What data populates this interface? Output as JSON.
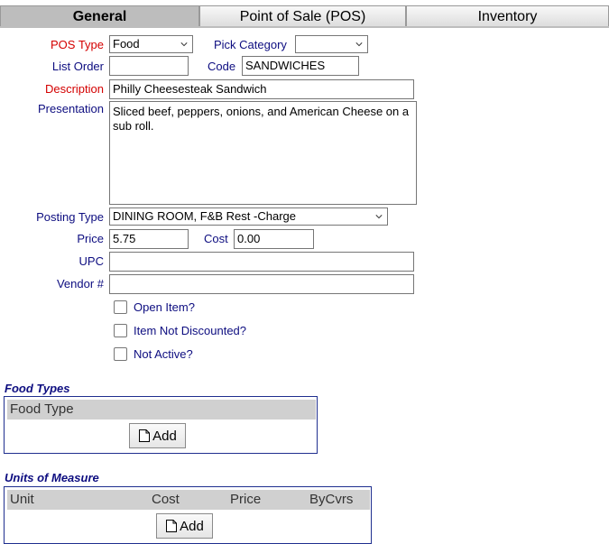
{
  "tabs": [
    {
      "label": "General",
      "active": true
    },
    {
      "label": "Point of Sale (POS)",
      "active": false
    },
    {
      "label": "Inventory",
      "active": false
    }
  ],
  "form": {
    "pos_type_label": "POS Type",
    "pos_type_value": "Food",
    "pick_category_label": "Pick Category",
    "pick_category_value": "",
    "list_order_label": "List Order",
    "list_order_value": "",
    "code_label": "Code",
    "code_value": "SANDWICHES",
    "description_label": "Description",
    "description_value": "Philly Cheesesteak Sandwich",
    "presentation_label": "Presentation",
    "presentation_value": "Sliced beef, peppers, onions, and American Cheese on a sub roll.",
    "posting_type_label": "Posting Type",
    "posting_type_value": "DINING ROOM, F&B Rest -Charge",
    "price_label": "Price",
    "price_value": "5.75",
    "cost_label": "Cost",
    "cost_value": "0.00",
    "upc_label": "UPC",
    "upc_value": "",
    "vendor_label": "Vendor #",
    "vendor_value": ""
  },
  "checkboxes": {
    "open_item": "Open Item?",
    "not_discounted": "Item Not Discounted?",
    "not_active": "Not Active?"
  },
  "food_types": {
    "title": "Food Types",
    "header": "Food Type",
    "add_label": "Add"
  },
  "units": {
    "title": "Units of Measure",
    "columns": [
      "Unit",
      "Cost",
      "Price",
      "ByCvrs"
    ],
    "add_label": "Add"
  },
  "colors": {
    "label_blue": "#0d0d80",
    "required_red": "#d40000",
    "header_gray": "#d0d0d0",
    "panel_border": "#1f2f8f"
  }
}
